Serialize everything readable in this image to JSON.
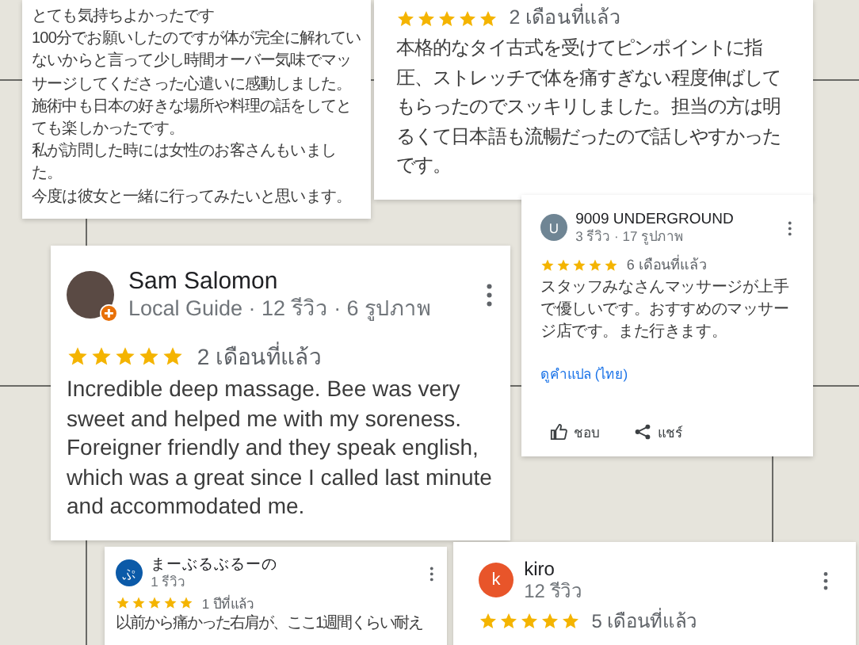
{
  "reviews": [
    {
      "paragraphs": [
        "とても気持ちよかったです",
        "100分でお願いしたのですが体が完全に解れていないからと言って少し時間オーバー気味でマッサージしてくださった心遣いに感動しました。",
        "施術中も日本の好きな場所や料理の話をしてとても楽しかったです。",
        "私が訪問した時には女性のお客さんもいました。",
        "今度は彼女と一緒に行ってみたいと思います。"
      ]
    },
    {
      "stars": 5,
      "time": "2 เดือนที่แล้ว",
      "text": "本格的なタイ古式を受けてピンポイントに指圧、ストレッチで体を痛すぎない程度伸ばしてもらったのでスッキリしました。担当の方は明るくて日本語も流暢だったので話しやすかったです。"
    },
    {
      "author": {
        "name": "Sam Salomon",
        "details": "Local Guide · 12 รีวิว · 6 รูปภาพ",
        "local_guide": true
      },
      "stars": 5,
      "time": "2 เดือนที่แล้ว",
      "text": "Incredible deep massage. Bee was very sweet and helped me with my soreness. Foreigner friendly and they speak english, which was a great since I called last minute and accommodated me."
    },
    {
      "author": {
        "name": "9009 UNDERGROUND",
        "details": "3 รีวิว · 17 รูปภาพ",
        "initial": "U",
        "color": "#6f8594"
      },
      "stars": 5,
      "time": "6 เดือนที่แล้ว",
      "text": "スタッフみなさんマッサージが上手で優しいです。おすすめのマッサージ店です。また行きます。",
      "translate": "ดูคำแปล (ไทย)",
      "actions": [
        {
          "kind": "like",
          "label": "ชอบ"
        },
        {
          "kind": "share",
          "label": "แชร์"
        }
      ]
    },
    {
      "author": {
        "name": "まーぶるぶるーの",
        "details": "1 รีวิว",
        "initial": "ぷ",
        "color": "#0b5aa8"
      },
      "stars": 5,
      "time": "1 ปีที่แล้ว",
      "text": "以前から痛かった右肩が、ここ1週間くらい耐え"
    },
    {
      "author": {
        "name": "kiro",
        "details": "12 รีวิว",
        "initial": "k",
        "color": "#e8552a"
      },
      "stars": 5,
      "time": "5 เดือนที่แล้ว"
    }
  ]
}
